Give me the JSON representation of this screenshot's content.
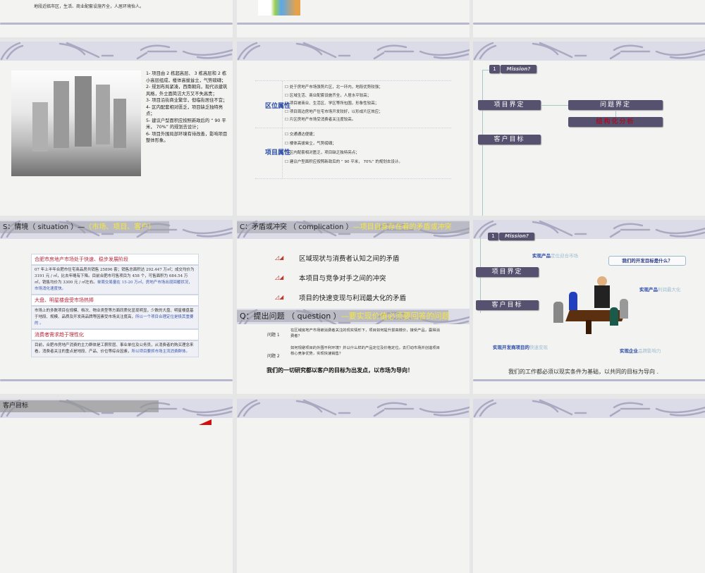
{
  "slide_top_left": {
    "text": "地段近临市区，生活、商业配套设施齐全，人居环境怡人。"
  },
  "slide_project_overview": {
    "points": [
      "1- 项目由 2 栋超高层、 3 栋高层和 2 栋小高层组成，楼体高拔耸立，气势磅礴；",
      "2- 规划布局紧凑，西南朝向，现代派建筑风格，外立面简洁大方又不失高贵；",
      "3- 项目沿街商业繁华，但临街居住不宜；",
      "4- 区内配套相对匮乏，项目缺乏独特亮点；",
      "5- 建议户型面积应按照新政后的 “ 90 平米， 70%” 的规划去设计；",
      "6- 项目外围局部环境有待改善，影响项目整体形象。"
    ]
  },
  "slide_attributes": {
    "location_label": "区位属性",
    "location_items": [
      "处于房地产市场强势片区，北一环内，地段优势较强；",
      "区域生活、商业配套设施齐全，人居水平较高；",
      "项目被商业、生活区、学区等所包围，形象性较高；",
      "项目周边房地产住宅市场开发较好，以形成片区效应；",
      "片区房地产市场受消费者关注度较高。"
    ],
    "project_label": "项目属性",
    "project_items": [
      "交通通达便捷；",
      "楼体高拔耸立，气势磅礴；",
      " 区内配套相对匮乏，项目缺乏独特亮点；",
      "建议户型面积应按照新政后的 “ 90 平米， 70%” 的规划去设计。"
    ]
  },
  "mission": {
    "num": "1",
    "label": "Mission?",
    "project_def": "项目界定",
    "problem_def": "问题界定",
    "structured": "结构化分析",
    "client_goal": "客户目标"
  },
  "situation": {
    "title_prefix": "S：情境（ situation ）—",
    "title_hl": "（市场、项目、客户）",
    "sections": [
      {
        "head": "合肥市房地产市场处于快速、稳步发展阶段",
        "body": "07 年上半年合肥市住宅商品房共销售 25896 套；销售总面积达 292.447 万㎡；成交均价为 3191 元 / ㎡，比去年略有下降。目前合肥市可售项目为 458 个，可售面积为 684.54 万㎡，销售均价为 3300 元 / ㎡左右。",
        "emph": "单周交易量在 15-20 万㎡，房地产市场出现回暖状况，市场消化速度快。"
      },
      {
        "head": "大盘、明星楼盘受市场热捧",
        "body": "市场上的多数项目在规模、档次、物业类型等方面同质化显现明显，少数的大盘、明星楼盘基于地段、规模、品质及开发商品牌等因素受市场关注度高，",
        "emph": "所以一个项目合理定位是极其重要的 。"
      },
      {
        "head": "消费者需求趋于理性化",
        "body": "目前，合肥市房地产消费的主力群体是工薪阶层、事业单位及公务员，从消费者的购买理念来看，消费者关注的重点是地段、产品、价位等综合因素，",
        "emph": "所以项目要抓市场主流消费群体。"
      }
    ]
  },
  "complication": {
    "title_prefix": "C：矛盾或冲突 （ complication ）",
    "title_hl": "—项目自身存在着的矛盾或冲突",
    "items": [
      "区域现状与消费者认知之间的矛盾",
      "本项目与竞争对手之间的冲突",
      "项目的快速变现与利润最大化的矛盾"
    ]
  },
  "question": {
    "title_prefix": "Q：提出问题 （ question ）",
    "title_hl": "—要实现价值必须要回答的问题",
    "q1_label": "问题 1",
    "q1": "在区域房地产市场被消费者关注的现实情形下，项目如何提升拔高楼价，接受产品，赢得消费者？",
    "q2_label": "问题 2",
    "q2": "如何规避项目的外围不利环境？并以什么样的产品定位及价格定位，去打动市场并创造项目核心竞争优势，实现快速销售？",
    "conclusion": "我们的一切研究都以客户的目标为出发点，以市场为导向！"
  },
  "goals": {
    "g1a": "实现产品",
    "g1b": "定位迎合市场",
    "bubble": "我们的开发目标是什么？",
    "g2a": "实现产品",
    "g2b": "利润最大化",
    "g3a": "实现开发商项目的",
    "g3b": "快速变现",
    "g4a": "实现企业",
    "g4b": "品牌影响力",
    "conclusion": "我们的工作都必须以现实条件为基础，以共同的目标为导向 ."
  },
  "bottom_left": {
    "title": "客户目标"
  }
}
